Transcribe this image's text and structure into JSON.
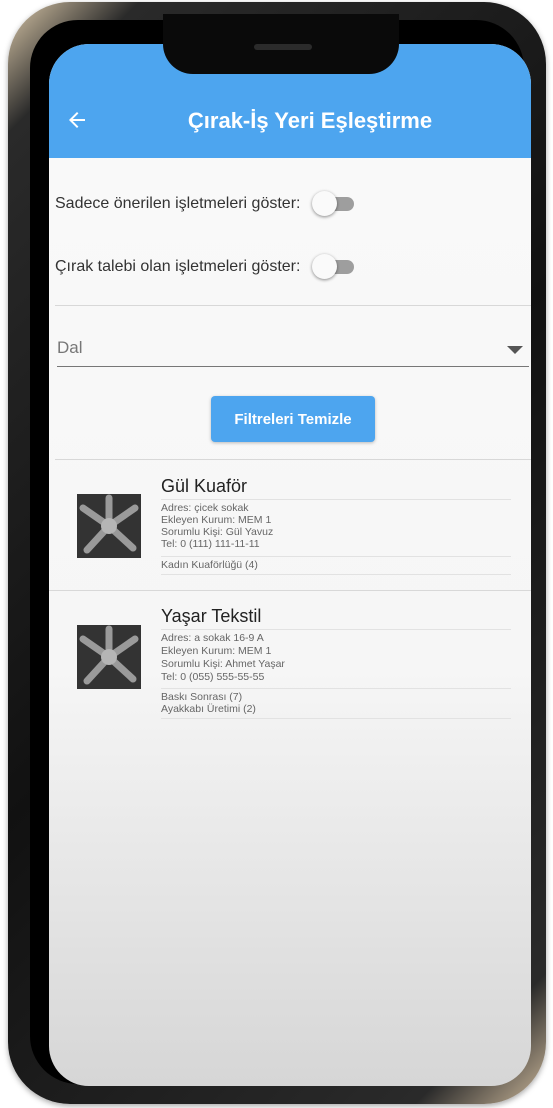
{
  "app": {
    "title": "Çırak-İş Yeri Eşleştirme"
  },
  "filters": {
    "toggle_recommended_label": "Sadece önerilen işletmeleri göster:",
    "toggle_recommended_on": false,
    "toggle_apprentice_label": "Çırak talebi olan işletmeleri göster:",
    "toggle_apprentice_on": false,
    "dropdown_placeholder": "Dal",
    "clear_button_label": "Filtreleri Temizle"
  },
  "businesses": [
    {
      "name": "Gül Kuaför",
      "address": "Adres: çicek sokak",
      "institution": "Ekleyen Kurum: MEM 1",
      "contact": "Sorumlu Kişi: Gül Yavuz",
      "phone": "Tel: 0 (111) 111-11-11",
      "branches": [
        "Kadın Kuaförlüğü (4)"
      ]
    },
    {
      "name": "Yaşar Tekstil",
      "address": "Adres: a sokak 16-9 A",
      "institution": "Ekleyen Kurum: MEM 1",
      "contact": "Sorumlu Kişi: Ahmet Yaşar",
      "phone": "Tel: 0 (055) 555-55-55",
      "branches": [
        "Baskı Sonrası  (7)",
        "Ayakkabı Üretimi  (2)"
      ]
    }
  ],
  "colors": {
    "appbar": "#4da5ef",
    "button": "#4da5ef"
  }
}
